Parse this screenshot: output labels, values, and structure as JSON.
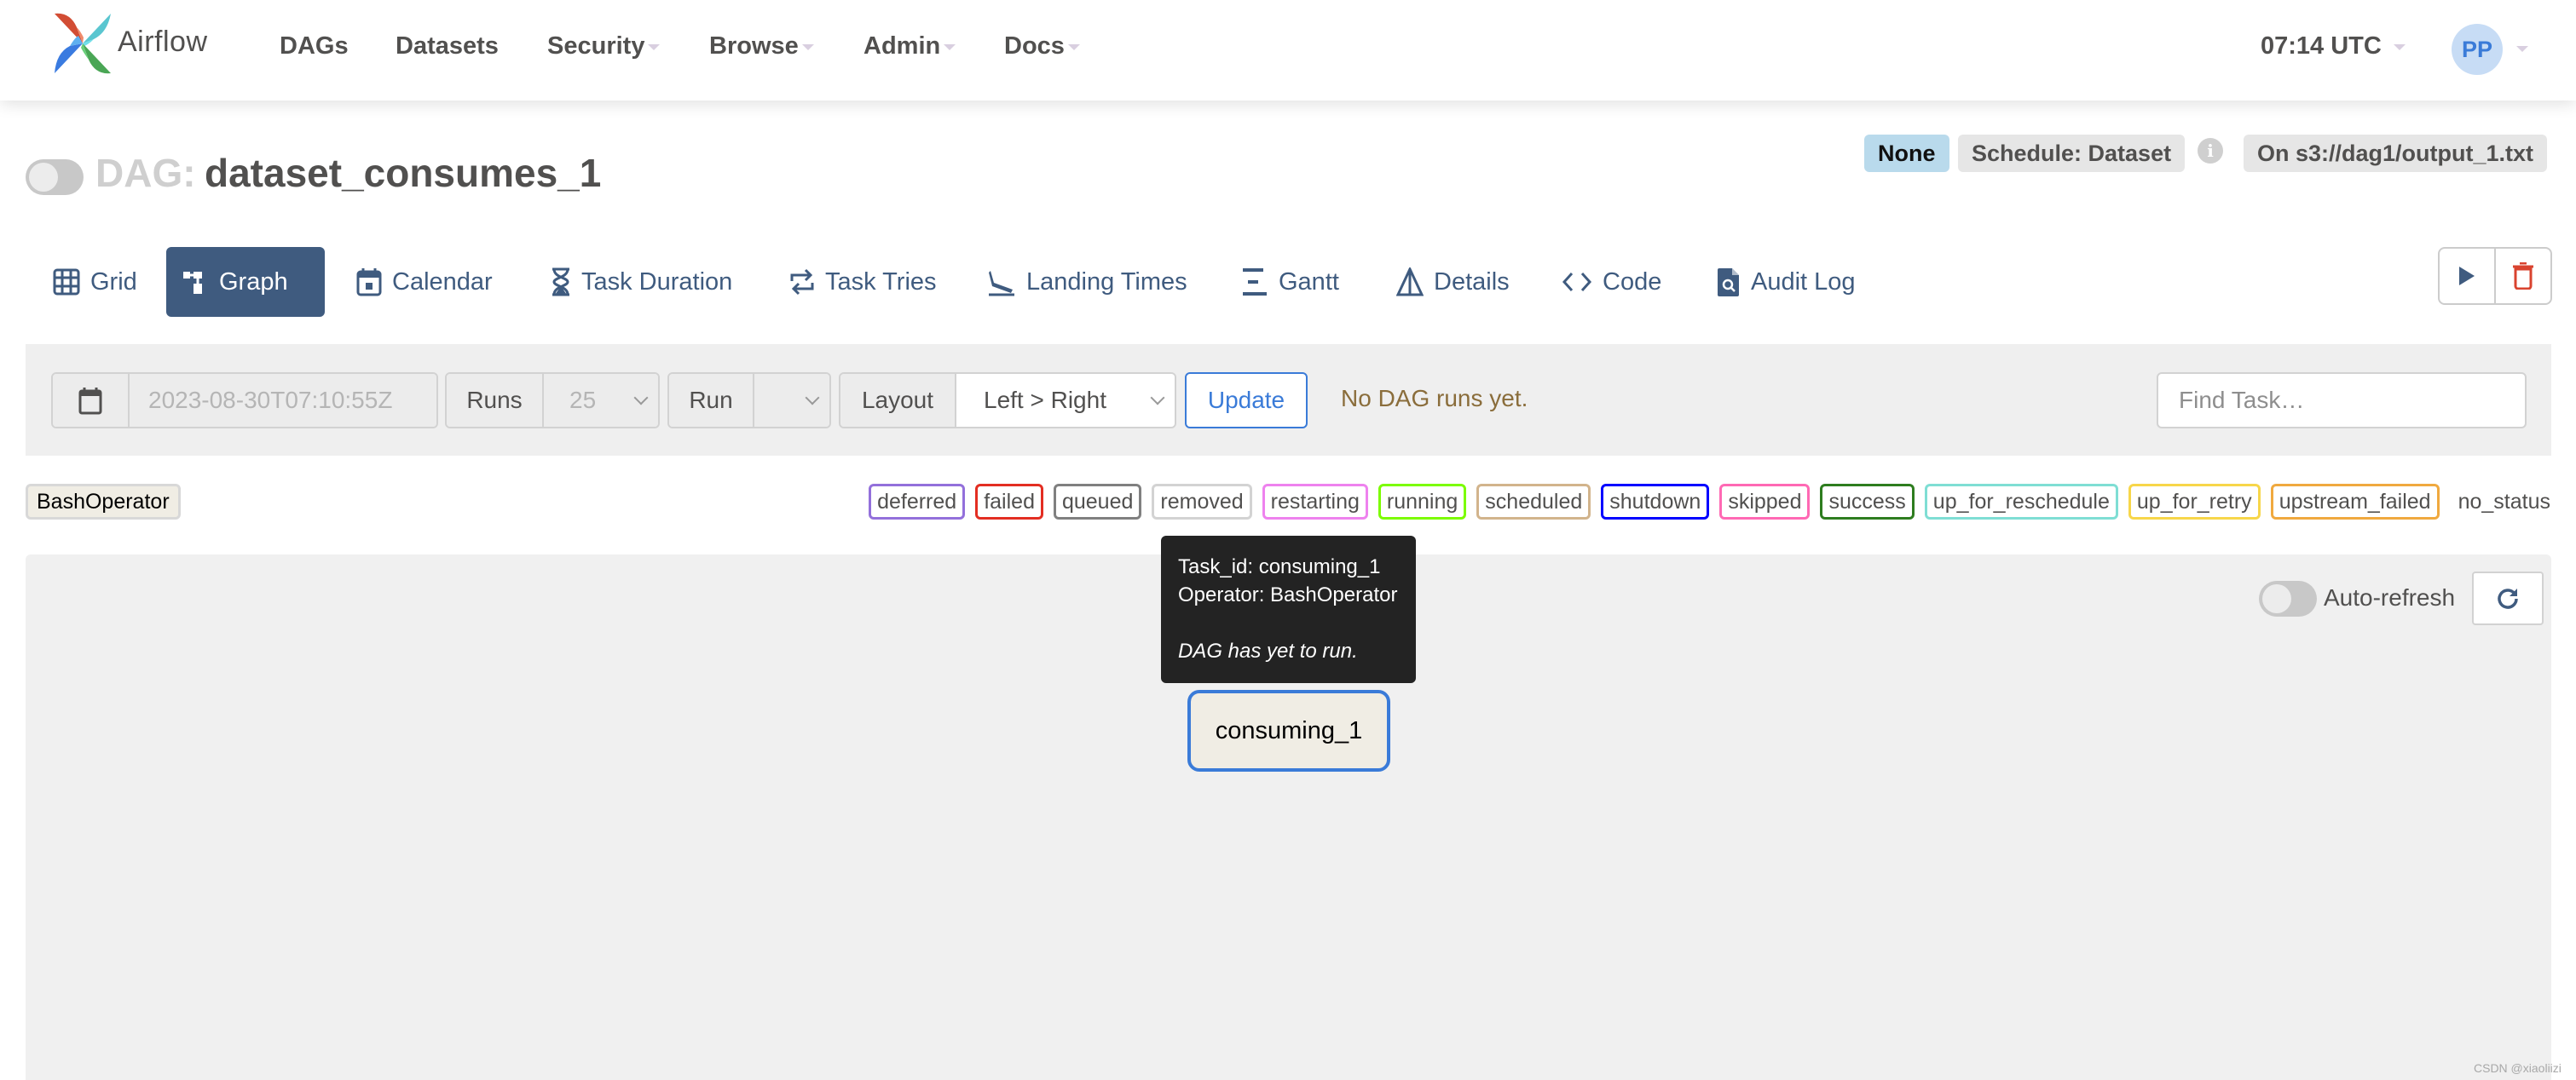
{
  "navbar": {
    "brand": "Airflow",
    "items": [
      {
        "label": "DAGs",
        "dropdown": false
      },
      {
        "label": "Datasets",
        "dropdown": false
      },
      {
        "label": "Security",
        "dropdown": true
      },
      {
        "label": "Browse",
        "dropdown": true
      },
      {
        "label": "Admin",
        "dropdown": true
      },
      {
        "label": "Docs",
        "dropdown": true
      }
    ],
    "time": "07:14 UTC",
    "user_initials": "PP"
  },
  "dag": {
    "prefix": "DAG:",
    "name": "dataset_consumes_1",
    "paused": true,
    "badges": {
      "status": "None",
      "schedule": "Schedule: Dataset",
      "info_icon": "info-icon",
      "dataset": "On s3://dag1/output_1.txt"
    }
  },
  "tabs": [
    {
      "label": "Grid",
      "icon": "grid-icon",
      "active": false
    },
    {
      "label": "Graph",
      "icon": "graph-icon",
      "active": true
    },
    {
      "label": "Calendar",
      "icon": "calendar-icon",
      "active": false
    },
    {
      "label": "Task Duration",
      "icon": "hourglass-icon",
      "active": false
    },
    {
      "label": "Task Tries",
      "icon": "retry-icon",
      "active": false
    },
    {
      "label": "Landing Times",
      "icon": "plane-landing-icon",
      "active": false
    },
    {
      "label": "Gantt",
      "icon": "gantt-icon",
      "active": false
    },
    {
      "label": "Details",
      "icon": "details-icon",
      "active": false
    },
    {
      "label": "Code",
      "icon": "code-icon",
      "active": false
    },
    {
      "label": "Audit Log",
      "icon": "audit-log-icon",
      "active": false
    }
  ],
  "actions": {
    "trigger": "play-icon",
    "delete": "trash-icon"
  },
  "controls": {
    "base_date": "2023-08-30T07:10:55Z",
    "runs_label": "Runs",
    "runs_value": "25",
    "run_label": "Run",
    "run_value": "",
    "layout_label": "Layout",
    "layout_value": "Left > Right",
    "update_label": "Update",
    "status_message": "No DAG runs yet.",
    "find_task_placeholder": "Find Task…"
  },
  "legend": {
    "operator": "BashOperator",
    "states": [
      {
        "label": "deferred",
        "color": "#9370db"
      },
      {
        "label": "failed",
        "color": "#e32e22"
      },
      {
        "label": "queued",
        "color": "#808080"
      },
      {
        "label": "removed",
        "color": "#d3d3d3"
      },
      {
        "label": "restarting",
        "color": "#ee82ee"
      },
      {
        "label": "running",
        "color": "#7cfc00"
      },
      {
        "label": "scheduled",
        "color": "#d2b48c"
      },
      {
        "label": "shutdown",
        "color": "#0000ff"
      },
      {
        "label": "skipped",
        "color": "#ff69b4"
      },
      {
        "label": "success",
        "color": "#2e7d1f"
      },
      {
        "label": "up_for_reschedule",
        "color": "#7fded4"
      },
      {
        "label": "up_for_retry",
        "color": "#f7d64a"
      },
      {
        "label": "upstream_failed",
        "color": "#f0a93f"
      }
    ],
    "no_status": "no_status"
  },
  "graph": {
    "auto_refresh_label": "Auto-refresh",
    "auto_refresh_on": false,
    "tooltip": {
      "task_id": "Task_id: consuming_1",
      "operator": "Operator: BashOperator",
      "note": "DAG has yet to run."
    },
    "nodes": [
      {
        "label": "consuming_1",
        "operator": "BashOperator"
      }
    ]
  },
  "watermark": "CSDN @xiaoliizi",
  "colors": {
    "primary": "#3f5b7f",
    "link": "#3a7bd8",
    "danger": "#d9432f",
    "warning_text": "#8a6d3b"
  }
}
